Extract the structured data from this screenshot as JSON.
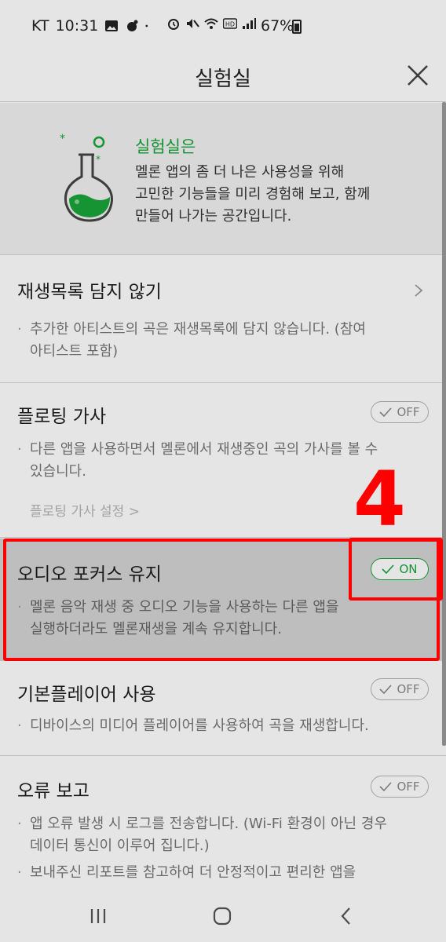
{
  "status_bar": {
    "carrier": "KT",
    "time": "10:31",
    "battery": "67%"
  },
  "header": {
    "title": "실험실"
  },
  "intro": {
    "title": "실험실은",
    "line1": "멜론 앱의 좀 더 나은 사용성을 위해",
    "line2": "고민한 기능들을 미리 경험해 보고, 함께",
    "line3": "만들어 나가는 공간입니다."
  },
  "sections": {
    "playlist": {
      "title": "재생목록 담지 않기",
      "desc1": "추가한 아티스트의 곡은 재생목록에 담지 않습니다. (참여",
      "desc2": "아티스트 포함)"
    },
    "floating": {
      "title": "플로팅 가사",
      "toggle": "OFF",
      "desc1": "다른 앱을 사용하면서 멜론에서 재생중인 곡의 가사를 볼 수",
      "desc2": "있습니다.",
      "link": "플로팅 가사 설정 >"
    },
    "audio_focus": {
      "title": "오디오 포커스 유지",
      "toggle": "ON",
      "desc1": "멜론 음악 재생 중 오디오 기능을 사용하는 다른 앱을",
      "desc2": "실행하더라도 멜론재생을 계속 유지합니다."
    },
    "default_player": {
      "title": "기본플레이어 사용",
      "toggle": "OFF",
      "desc1": "디바이스의 미디어 플레이어를 사용하여 곡을 재생합니다."
    },
    "error_report": {
      "title": "오류 보고",
      "toggle": "OFF",
      "desc1": "앱 오류 발생 시 로그를 전송합니다. (Wi-Fi 환경이 아닌 경우",
      "desc2": "데이터 통신이 이루어 집니다.)",
      "desc3": "보내주신 리포트를 참고하여 더 안정적이고 편리한 앱을"
    }
  },
  "annotation": {
    "number": "4"
  },
  "colors": {
    "accent_green": "#19a53a",
    "annotation_red": "#ff0000"
  }
}
